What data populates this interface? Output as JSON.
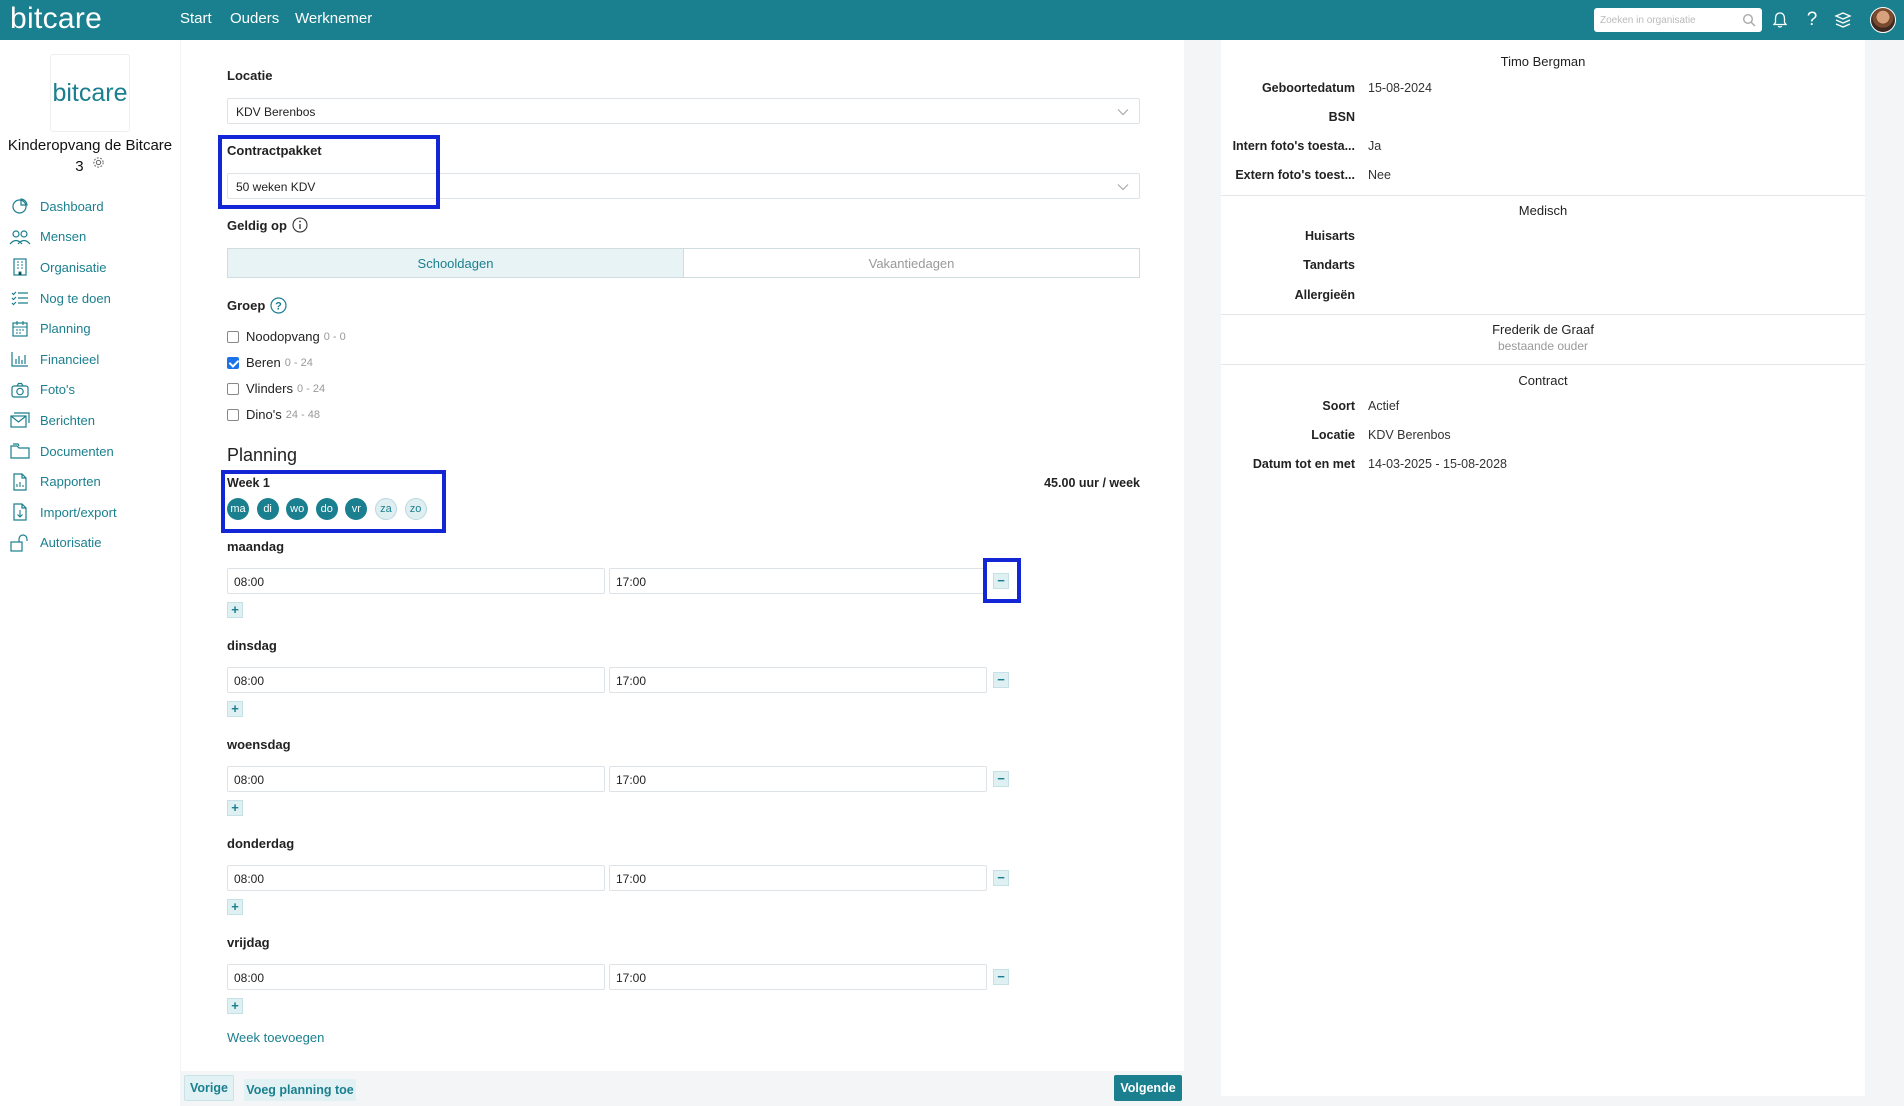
{
  "topbar": {
    "brand": "bitcare",
    "nav": [
      "Start",
      "Ouders",
      "Werknemer"
    ],
    "search_placeholder": "Zoeken in organisatie",
    "icons": [
      "search-icon",
      "bell-icon",
      "help-icon",
      "inbox-stack-icon",
      "avatar"
    ]
  },
  "sidebar": {
    "logo": "bitcare",
    "org_name": "Kinderopvang de Bitcare",
    "org_number": "3",
    "items": [
      {
        "label": "Dashboard",
        "icon": "pie-chart-icon"
      },
      {
        "label": "Mensen",
        "icon": "people-icon"
      },
      {
        "label": "Organisatie",
        "icon": "building-icon"
      },
      {
        "label": "Nog te doen",
        "icon": "checklist-icon"
      },
      {
        "label": "Planning",
        "icon": "calendar-icon"
      },
      {
        "label": "Financieel",
        "icon": "bar-chart-icon"
      },
      {
        "label": "Foto's",
        "icon": "camera-icon"
      },
      {
        "label": "Berichten",
        "icon": "messages-icon"
      },
      {
        "label": "Documenten",
        "icon": "folder-icon"
      },
      {
        "label": "Rapporten",
        "icon": "report-icon"
      },
      {
        "label": "Import/export",
        "icon": "import-export-icon"
      },
      {
        "label": "Autorisatie",
        "icon": "unlock-icon"
      }
    ]
  },
  "form": {
    "locatie_label": "Locatie",
    "locatie_value": "KDV Berenbos",
    "contract_label": "Contractpakket",
    "contract_value": "50 weken KDV",
    "geldig_label": "Geldig op",
    "seg_on": "Schooldagen",
    "seg_off": "Vakantiedagen",
    "groep_label": "Groep",
    "groups": [
      {
        "name": "Noodopvang",
        "range": "0 - 0",
        "checked": false
      },
      {
        "name": "Beren",
        "range": "0 - 24",
        "checked": true
      },
      {
        "name": "Vlinders",
        "range": "0 - 24",
        "checked": false
      },
      {
        "name": "Dino's",
        "range": "24 - 48",
        "checked": false
      }
    ],
    "planning_title": "Planning",
    "week_label": "Week 1",
    "hours_per_week": "45.00 uur / week",
    "weekdays": [
      {
        "abbr": "ma",
        "on": true
      },
      {
        "abbr": "di",
        "on": true
      },
      {
        "abbr": "wo",
        "on": true
      },
      {
        "abbr": "do",
        "on": true
      },
      {
        "abbr": "vr",
        "on": true
      },
      {
        "abbr": "za",
        "on": false
      },
      {
        "abbr": "zo",
        "on": false
      }
    ],
    "days": [
      {
        "name": "maandag",
        "from": "08:00",
        "to": "17:00"
      },
      {
        "name": "dinsdag",
        "from": "08:00",
        "to": "17:00"
      },
      {
        "name": "woensdag",
        "from": "08:00",
        "to": "17:00"
      },
      {
        "name": "donderdag",
        "from": "08:00",
        "to": "17:00"
      },
      {
        "name": "vrijdag",
        "from": "08:00",
        "to": "17:00"
      }
    ],
    "minus": "−",
    "plus": "+",
    "add_week": "Week toevoegen"
  },
  "footer": {
    "prev": "Vorige",
    "add_planning": "Voeg planning toe",
    "next": "Volgende"
  },
  "colors": {
    "brand": "#1a7f8e",
    "highlight": "#1326d6"
  },
  "details": {
    "child_name": "Timo Bergman",
    "rows": [
      {
        "k": "Geboortedatum",
        "v": "15-08-2024"
      },
      {
        "k": "BSN",
        "v": ""
      },
      {
        "k": "Intern foto's toesta...",
        "v": "Ja"
      },
      {
        "k": "Extern foto's toest...",
        "v": "Nee"
      }
    ],
    "medisch_title": "Medisch",
    "medisch_rows": [
      {
        "k": "Huisarts",
        "v": ""
      },
      {
        "k": "Tandarts",
        "v": ""
      },
      {
        "k": "Allergieën",
        "v": ""
      }
    ],
    "parent_name": "Frederik de Graaf",
    "parent_sub": "bestaande ouder",
    "contract_title": "Contract",
    "contract_rows": [
      {
        "k": "Soort",
        "v": "Actief"
      },
      {
        "k": "Locatie",
        "v": "KDV Berenbos"
      },
      {
        "k": "Datum tot en met",
        "v": "14-03-2025 - 15-08-2028"
      }
    ]
  }
}
